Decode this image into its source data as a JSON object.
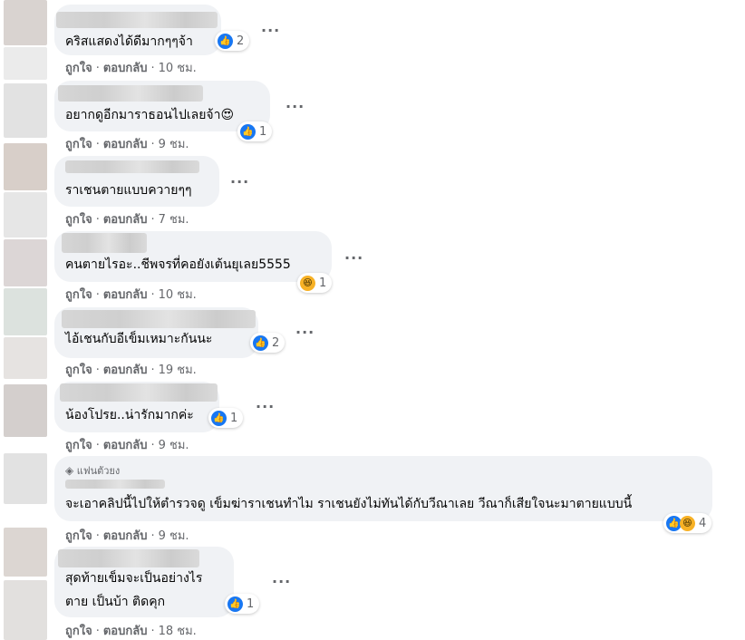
{
  "actions": {
    "like": "ถูกใจ",
    "reply": "ตอบกลับ",
    "sep": "·"
  },
  "more_label": "···",
  "badge": {
    "label": "แฟนตัวยง",
    "icon": "diamond-icon"
  },
  "comments": [
    {
      "text": "คริสแสดงได้ดีมากๆๆจ้า",
      "time": "10 ชม.",
      "reactions": [
        "like"
      ],
      "count": "2"
    },
    {
      "text": "อยากดูอีกมาราธอนไปเลยจ้า😍",
      "time": "9 ชม.",
      "reactions": [
        "like"
      ],
      "count": "1"
    },
    {
      "text": "ราเชนตายแบบควายๆๆ",
      "time": "7 ชม.",
      "reactions": [],
      "count": ""
    },
    {
      "text": "คนตายไรอะ..ชีพจรที่คอยังเต้นยุเลย5555",
      "time": "10 ชม.",
      "reactions": [
        "haha"
      ],
      "count": "1"
    },
    {
      "text": "ไอ้เชนกับอีเข็มเหมาะกันนะ",
      "time": "19 ชม.",
      "reactions": [
        "like"
      ],
      "count": "2"
    },
    {
      "text": "น้องโปรย..น่ารักมากค่ะ",
      "time": "9 ชม.",
      "reactions": [
        "like"
      ],
      "count": "1"
    },
    {
      "text": "จะเอาคลิปนี้ไปให้ตำรวจดู เข็มฆ่าราเชนทำไม ราเชนยังไม่ทันได้กับวีณาเลย วีณาก็เสียใจนะมาตายแบบนี้",
      "time": "9 ชม.",
      "reactions": [
        "like",
        "haha"
      ],
      "count": "4"
    },
    {
      "text_line1": "สุดท้ายเข็มจะเป็นอย่างไร",
      "text_line2": "ตาย เป็นบ้า ติดคุก",
      "time": "18 ชม.",
      "reactions": [
        "like"
      ],
      "count": "1"
    }
  ],
  "colors": {
    "bubble": "#f0f2f5",
    "like": "#1877f2",
    "meta": "#65676b"
  }
}
